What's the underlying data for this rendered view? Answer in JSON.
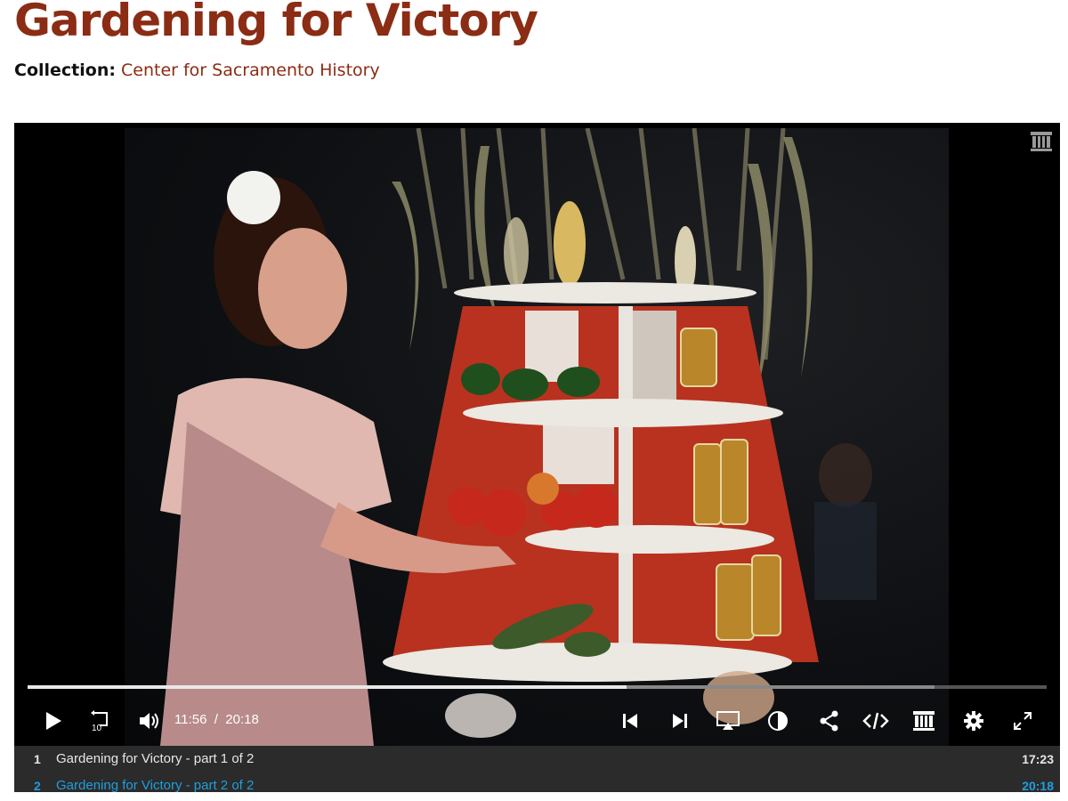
{
  "page": {
    "title": "Gardening for Victory",
    "collection_label": "Collection:",
    "collection_link": "Center for Sacramento History"
  },
  "player": {
    "current_time": "11:56",
    "separator": "/",
    "duration": "20:18",
    "progress_fraction": 0.588,
    "buffered_fraction": 0.89,
    "rewind_label": "10",
    "icons": [
      "play-icon",
      "rewind-10-icon",
      "volume-icon",
      "previous-track-icon",
      "next-track-icon",
      "airplay-icon",
      "captions-icon",
      "share-icon",
      "embed-icon",
      "archive-icon",
      "settings-icon",
      "fullscreen-icon"
    ]
  },
  "playlist": [
    {
      "num": "1",
      "title": "Gardening for Victory - part 1 of 2",
      "duration": "17:23",
      "active": false
    },
    {
      "num": "2",
      "title": "Gardening for Victory - part 2 of 2",
      "duration": "20:18",
      "active": true
    }
  ],
  "colors": {
    "title": "#8b2c14",
    "link": "#8b2c14",
    "active_track": "#1e9fe0",
    "playlist_bg": "#2b2b2b"
  }
}
